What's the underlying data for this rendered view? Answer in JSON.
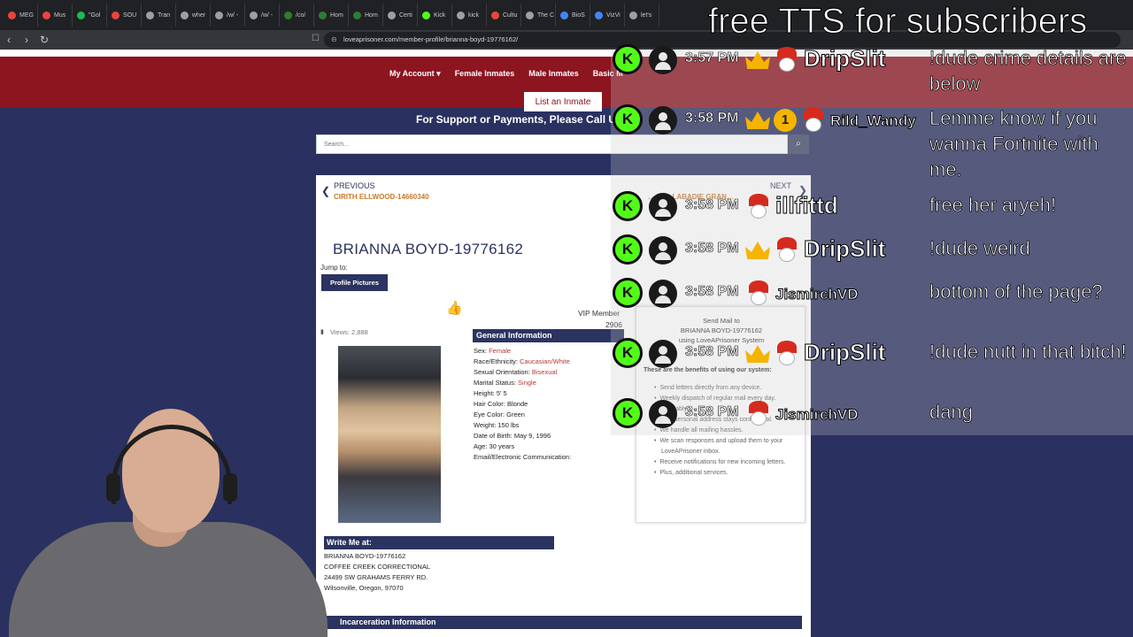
{
  "browser": {
    "tabs": [
      {
        "label": "MEG",
        "color": "#e8453c"
      },
      {
        "label": "Mus",
        "color": "#e8453c"
      },
      {
        "label": "\"Gol",
        "color": "#1db954"
      },
      {
        "label": "SOU",
        "color": "#e8453c"
      },
      {
        "label": "Tran",
        "color": "#9aa0a6"
      },
      {
        "label": "wher",
        "color": "#9aa0a6"
      },
      {
        "label": "/w/ -",
        "color": "#9aa0a6"
      },
      {
        "label": "/w/ -",
        "color": "#9aa0a6"
      },
      {
        "label": "/co/",
        "color": "#2e7d32"
      },
      {
        "label": "Hom",
        "color": "#2e7d32"
      },
      {
        "label": "Hom",
        "color": "#2e7d32"
      },
      {
        "label": "Certi",
        "color": "#9aa0a6"
      },
      {
        "label": "Kick",
        "color": "#53fc18"
      },
      {
        "label": "kick",
        "color": "#9aa0a6"
      },
      {
        "label": "Cultu",
        "color": "#e8453c"
      },
      {
        "label": "The C",
        "color": "#9aa0a6"
      },
      {
        "label": "BioS",
        "color": "#4285f4"
      },
      {
        "label": "VizVi",
        "color": "#4285f4"
      },
      {
        "label": "let's",
        "color": "#9aa0a6"
      }
    ],
    "url": "loveaprisoner.com/member-profile/brianna-boyd-19776162/"
  },
  "overlay": {
    "tts_banner": "free TTS for subscribers"
  },
  "site": {
    "menu": [
      "My Account ▾",
      "Female Inmates",
      "Male Inmates",
      "Basic M"
    ],
    "list_button": "List an Inmate",
    "support": "For Support or Payments, Please Call Us",
    "search_placeholder": "Search..."
  },
  "profile": {
    "prev_label": "PREVIOUS",
    "prev_name": "CIRITH ELLWOOD-14660340",
    "next_label": "NEXT",
    "next_name": "…ARD LABADIE GRAN…",
    "name": "BRIANNA BOYD-19776162",
    "jump_to": "Jump to:",
    "profile_pictures": "Profile Pictures",
    "vip": "VIP Member",
    "vip_num": "2906",
    "views": "Views: 2,888",
    "general_header": "General Information",
    "general": [
      {
        "label": "Sex: ",
        "value": "Female",
        "style": "link"
      },
      {
        "label": "Race/Ethnicity: ",
        "value": "Caucasian/White",
        "style": "link"
      },
      {
        "label": "Sexual Orientation: ",
        "value": "Bisexual",
        "style": "link"
      },
      {
        "label": "Marital Status: ",
        "value": "Single",
        "style": "link"
      },
      {
        "label": "Height: ",
        "value": "5' 5",
        "style": "plain"
      },
      {
        "label": "Hair Color: ",
        "value": "Blonde",
        "style": "plain"
      },
      {
        "label": "Eye Color: ",
        "value": "Green",
        "style": "plain"
      },
      {
        "label": "Weight: ",
        "value": "150 lbs",
        "style": "plain"
      },
      {
        "label": "Date of Birth: ",
        "value": "May 9, 1996",
        "style": "plain"
      },
      {
        "label": "Age: ",
        "value": "30 years",
        "style": "plain"
      },
      {
        "label": "Email/Electronic Communication:",
        "value": "",
        "style": "plain"
      }
    ],
    "write_header": "Write Me at:",
    "address": [
      "BRIANNA BOYD-19776162",
      "COFFEE CREEK CORRECTIONAL",
      "24499 SW GRAHAMS FERRY RD.",
      "Wilsonville, Oregon, 97070"
    ],
    "incarceration_header": "Incarceration Information"
  },
  "mail": {
    "title": [
      "Send Mail to",
      "BRIANNA BOYD-19776162",
      "using LoveAPrisoner System"
    ],
    "benefits_header": "These are the benefits of using our system:",
    "benefits": [
      "Send letters directly from any device.",
      "Weekly dispatch of regular mail every day.",
      "affordably.",
      "Your personal address stays confidential.",
      "We handle all mailing hassles.",
      "We scan responses and upload them to your LoveAPrisoner inbox.",
      "Receive notifications for new incoming letters.",
      "Plus, additional services."
    ]
  },
  "chat": [
    {
      "time": "3:57 PM",
      "user": "DripSlit",
      "text": "!dude crime details are below",
      "crown": true,
      "gold": ""
    },
    {
      "time": "3:58 PM",
      "user": "Rild_Wandy",
      "text": "Lemme know if you wanna Fortnite with me.",
      "crown": true,
      "gold": "1"
    },
    {
      "time": "3:58 PM",
      "user": "illfittd",
      "text": "free her aryeh!",
      "crown": false,
      "gold": ""
    },
    {
      "time": "3:58 PM",
      "user": "DripSlit",
      "text": "!dude weird",
      "crown": true,
      "gold": ""
    },
    {
      "time": "3:58 PM",
      "user": "JismirchVD",
      "text": "bottom of the page?",
      "crown": false,
      "gold": ""
    },
    {
      "time": "3:58 PM",
      "user": "DripSlit",
      "text": "!dude nutt in that bitch!",
      "crown": true,
      "gold": ""
    },
    {
      "time": "3:58 PM",
      "user": "JismirchVD",
      "text": "dang",
      "crown": false,
      "gold": ""
    }
  ],
  "icons": {
    "kick_letter": "K",
    "search": "🔍",
    "thumbs_up": "👍",
    "back": "‹",
    "forward": "›",
    "reload": "↻",
    "prev_arrow": "❮",
    "next_arrow": "❯"
  }
}
